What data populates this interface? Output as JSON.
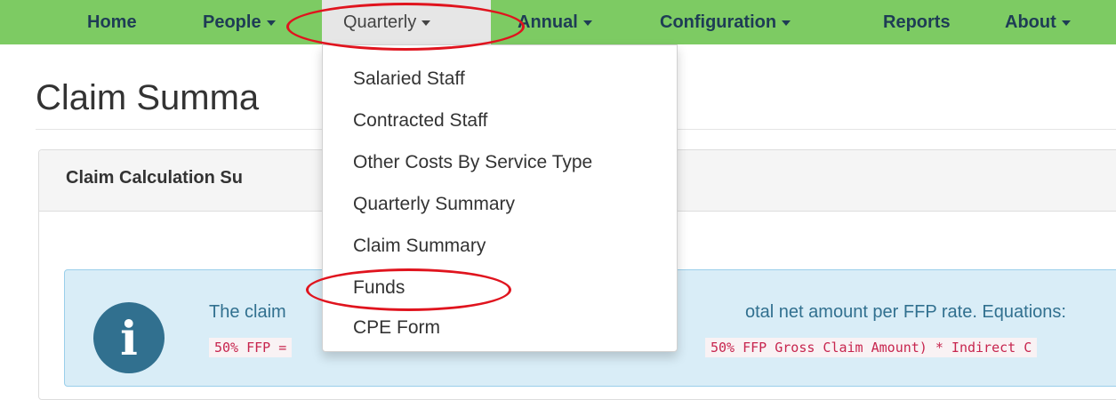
{
  "navbar": {
    "items": [
      {
        "label": "Home",
        "has_caret": false
      },
      {
        "label": "People",
        "has_caret": true
      },
      {
        "label": "Quarterly",
        "has_caret": true,
        "active": true
      },
      {
        "label": "Annual",
        "has_caret": true
      },
      {
        "label": "Configuration",
        "has_caret": true
      },
      {
        "label": "Reports",
        "has_caret": false
      },
      {
        "label": "About",
        "has_caret": true
      }
    ],
    "background_color": "#7dcb63"
  },
  "dropdown": {
    "items": [
      {
        "label": "Salaried Staff"
      },
      {
        "label": "Contracted Staff"
      },
      {
        "label": "Other Costs By Service Type"
      },
      {
        "label": "Quarterly Summary"
      },
      {
        "label": "Claim Summary"
      },
      {
        "label": "Funds"
      },
      {
        "label": "CPE Form"
      }
    ]
  },
  "page": {
    "title": "Claim Summa"
  },
  "panel": {
    "title": "Claim Calculation Su"
  },
  "alert": {
    "text_left": "The claim",
    "text_right": "otal net amount per FFP rate. Equations:",
    "code_left": "50% FFP =",
    "code_right": "50% FFP Gross Claim Amount) * Indirect C",
    "icon": "info-circle-icon"
  },
  "annotations": {
    "color": "#e0141e",
    "highlighted": [
      "Quarterly",
      "Funds"
    ]
  }
}
